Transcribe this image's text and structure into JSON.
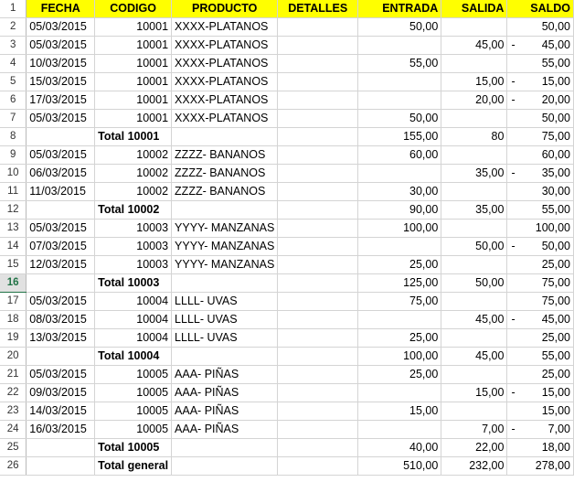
{
  "headers": [
    "FECHA",
    "CODIGO",
    "PRODUCTO",
    "DETALLES",
    "ENTRADA",
    "SALIDA",
    "SALDO"
  ],
  "active_row": 16,
  "rows": [
    {
      "n": "2",
      "fecha": "05/03/2015",
      "codigo": "10001",
      "producto": "XXXX-PLATANOS",
      "entrada": "50,00",
      "salida": "",
      "dash": "",
      "saldo": "50,00"
    },
    {
      "n": "3",
      "fecha": "05/03/2015",
      "codigo": "10001",
      "producto": "XXXX-PLATANOS",
      "entrada": "",
      "salida": "45,00",
      "dash": "-",
      "saldo": "45,00"
    },
    {
      "n": "4",
      "fecha": "10/03/2015",
      "codigo": "10001",
      "producto": "XXXX-PLATANOS",
      "entrada": "55,00",
      "salida": "",
      "dash": "",
      "saldo": "55,00"
    },
    {
      "n": "5",
      "fecha": "15/03/2015",
      "codigo": "10001",
      "producto": "XXXX-PLATANOS",
      "entrada": "",
      "salida": "15,00",
      "dash": "-",
      "saldo": "15,00"
    },
    {
      "n": "6",
      "fecha": "17/03/2015",
      "codigo": "10001",
      "producto": "XXXX-PLATANOS",
      "entrada": "",
      "salida": "20,00",
      "dash": "-",
      "saldo": "20,00"
    },
    {
      "n": "7",
      "fecha": "05/03/2015",
      "codigo": "10001",
      "producto": "XXXX-PLATANOS",
      "entrada": "50,00",
      "salida": "",
      "dash": "",
      "saldo": "50,00"
    },
    {
      "n": "8",
      "total": "Total 10001",
      "entrada": "155,00",
      "salida": "80",
      "dash": "",
      "saldo": "75,00"
    },
    {
      "n": "9",
      "fecha": "05/03/2015",
      "codigo": "10002",
      "producto": "ZZZZ- BANANOS",
      "entrada": "60,00",
      "salida": "",
      "dash": "",
      "saldo": "60,00"
    },
    {
      "n": "10",
      "fecha": "06/03/2015",
      "codigo": "10002",
      "producto": "ZZZZ- BANANOS",
      "entrada": "",
      "salida": "35,00",
      "dash": "-",
      "saldo": "35,00"
    },
    {
      "n": "11",
      "fecha": "11/03/2015",
      "codigo": "10002",
      "producto": "ZZZZ- BANANOS",
      "entrada": "30,00",
      "salida": "",
      "dash": "",
      "saldo": "30,00"
    },
    {
      "n": "12",
      "total": "Total 10002",
      "entrada": "90,00",
      "salida": "35,00",
      "dash": "",
      "saldo": "55,00"
    },
    {
      "n": "13",
      "fecha": "05/03/2015",
      "codigo": "10003",
      "producto": "YYYY- MANZANAS",
      "entrada": "100,00",
      "salida": "",
      "dash": "",
      "saldo": "100,00"
    },
    {
      "n": "14",
      "fecha": "07/03/2015",
      "codigo": "10003",
      "producto": "YYYY- MANZANAS",
      "entrada": "",
      "salida": "50,00",
      "dash": "-",
      "saldo": "50,00"
    },
    {
      "n": "15",
      "fecha": "12/03/2015",
      "codigo": "10003",
      "producto": "YYYY- MANZANAS",
      "entrada": "25,00",
      "salida": "",
      "dash": "",
      "saldo": "25,00"
    },
    {
      "n": "16",
      "total": "Total 10003",
      "entrada": "125,00",
      "salida": "50,00",
      "dash": "",
      "saldo": "75,00"
    },
    {
      "n": "17",
      "fecha": "05/03/2015",
      "codigo": "10004",
      "producto": "LLLL- UVAS",
      "entrada": "75,00",
      "salida": "",
      "dash": "",
      "saldo": "75,00"
    },
    {
      "n": "18",
      "fecha": "08/03/2015",
      "codigo": "10004",
      "producto": "LLLL- UVAS",
      "entrada": "",
      "salida": "45,00",
      "dash": "-",
      "saldo": "45,00"
    },
    {
      "n": "19",
      "fecha": "13/03/2015",
      "codigo": "10004",
      "producto": "LLLL- UVAS",
      "entrada": "25,00",
      "salida": "",
      "dash": "",
      "saldo": "25,00"
    },
    {
      "n": "20",
      "total": "Total 10004",
      "entrada": "100,00",
      "salida": "45,00",
      "dash": "",
      "saldo": "55,00"
    },
    {
      "n": "21",
      "fecha": "05/03/2015",
      "codigo": "10005",
      "producto": "AAA- PIÑAS",
      "entrada": "25,00",
      "salida": "",
      "dash": "",
      "saldo": "25,00"
    },
    {
      "n": "22",
      "fecha": "09/03/2015",
      "codigo": "10005",
      "producto": "AAA- PIÑAS",
      "entrada": "",
      "salida": "15,00",
      "dash": "-",
      "saldo": "15,00"
    },
    {
      "n": "23",
      "fecha": "14/03/2015",
      "codigo": "10005",
      "producto": "AAA- PIÑAS",
      "entrada": "15,00",
      "salida": "",
      "dash": "",
      "saldo": "15,00"
    },
    {
      "n": "24",
      "fecha": "16/03/2015",
      "codigo": "10005",
      "producto": "AAA- PIÑAS",
      "entrada": "",
      "salida": "7,00",
      "dash": "-",
      "saldo": "7,00"
    },
    {
      "n": "25",
      "total": "Total 10005",
      "entrada": "40,00",
      "salida": "22,00",
      "dash": "",
      "saldo": "18,00"
    },
    {
      "n": "26",
      "total": "Total general",
      "entrada": "510,00",
      "salida": "232,00",
      "dash": "",
      "saldo": "278,00"
    }
  ]
}
